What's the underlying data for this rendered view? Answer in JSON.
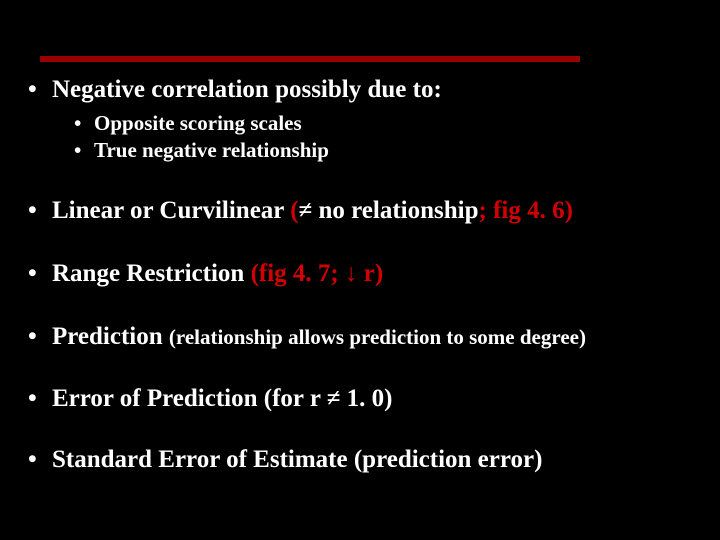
{
  "b1": {
    "text": "Negative correlation possibly due to:",
    "sub": [
      "Opposite scoring scales",
      "True negative relationship"
    ]
  },
  "b2": {
    "pre": "Linear  or  Curvilinear ",
    "par_open": "(",
    "neq": "≠ no relationship",
    "semi": "; ",
    "fig": "fig 4. 6",
    "par_close": ")"
  },
  "b3": {
    "pre": "Range Restriction ",
    "red": "(fig 4. 7; ↓ r)"
  },
  "b4": {
    "pre": "Prediction ",
    "rest": "(relationship allows prediction to some degree)"
  },
  "b5": "Error of Prediction (for r ≠ 1. 0)",
  "b6": "Standard Error of Estimate (prediction error)"
}
